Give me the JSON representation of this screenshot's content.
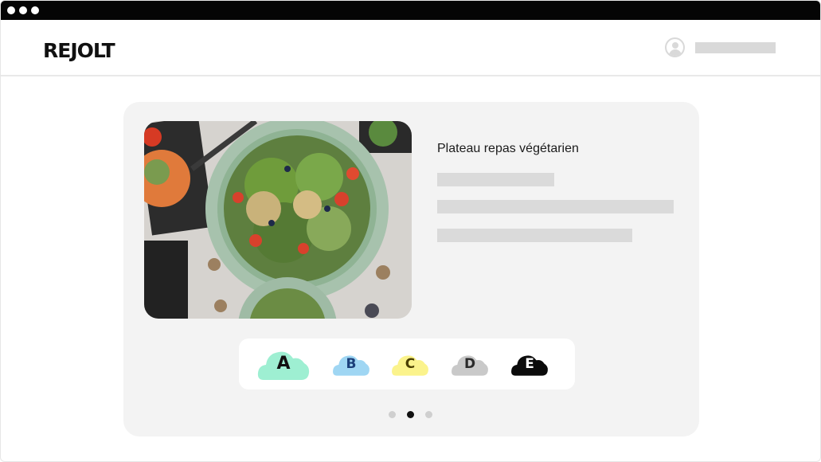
{
  "header": {
    "logo_text": "REJOLT",
    "user_name_visible": false
  },
  "product": {
    "title": "Plateau repas végétarien",
    "image_subject": "vegetarian pasta salad bowl",
    "text_lines_placeholder": true
  },
  "eco_score": {
    "grades": [
      {
        "label": "A",
        "color": "#9EEFD2",
        "selected": true
      },
      {
        "label": "B",
        "color": "#9FD6F3",
        "selected": false
      },
      {
        "label": "C",
        "color": "#FBF38C",
        "selected": false
      },
      {
        "label": "D",
        "color": "#C9C9C9",
        "selected": false
      },
      {
        "label": "E",
        "color": "#0B0B0B",
        "selected": false
      }
    ]
  },
  "carousel": {
    "page_count": 3,
    "current_page": 2
  },
  "colors": {
    "titlebar": "#050505",
    "card_background": "#F3F3F3",
    "placeholder": "#DADADA",
    "active_dot": "#111111",
    "inactive_dot": "#CFCFCF"
  }
}
